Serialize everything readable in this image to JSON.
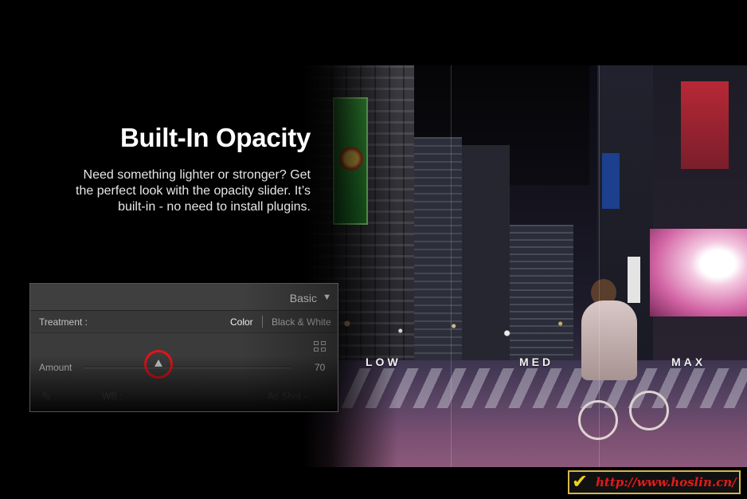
{
  "heading": {
    "title": "Built-In Opacity",
    "line1": "Need something lighter or stronger? Get",
    "line2": "the perfect look with the opacity slider. It’s",
    "line3": "built-in - no need to install plugins."
  },
  "photo": {
    "levels": [
      "LOW",
      "MED",
      "MAX"
    ]
  },
  "panel": {
    "title": "Basic",
    "caret_icon": "triangle-down-icon",
    "treatment": {
      "label": "Treatment :",
      "options": [
        "Color",
        "Black & White"
      ],
      "selected": "Color"
    },
    "amount": {
      "label": "Amount",
      "value": "70",
      "slider_fraction": 0.36
    },
    "wb": {
      "label": "WB :",
      "value": "As Shot –"
    }
  },
  "watermark": {
    "icon": "checkmark-icon",
    "text": "http://www.hoslin.cn/"
  },
  "colors": {
    "highlight_ring": "#e2141a",
    "watermark_border": "#d6b74a",
    "watermark_text": "#e11b1b"
  }
}
